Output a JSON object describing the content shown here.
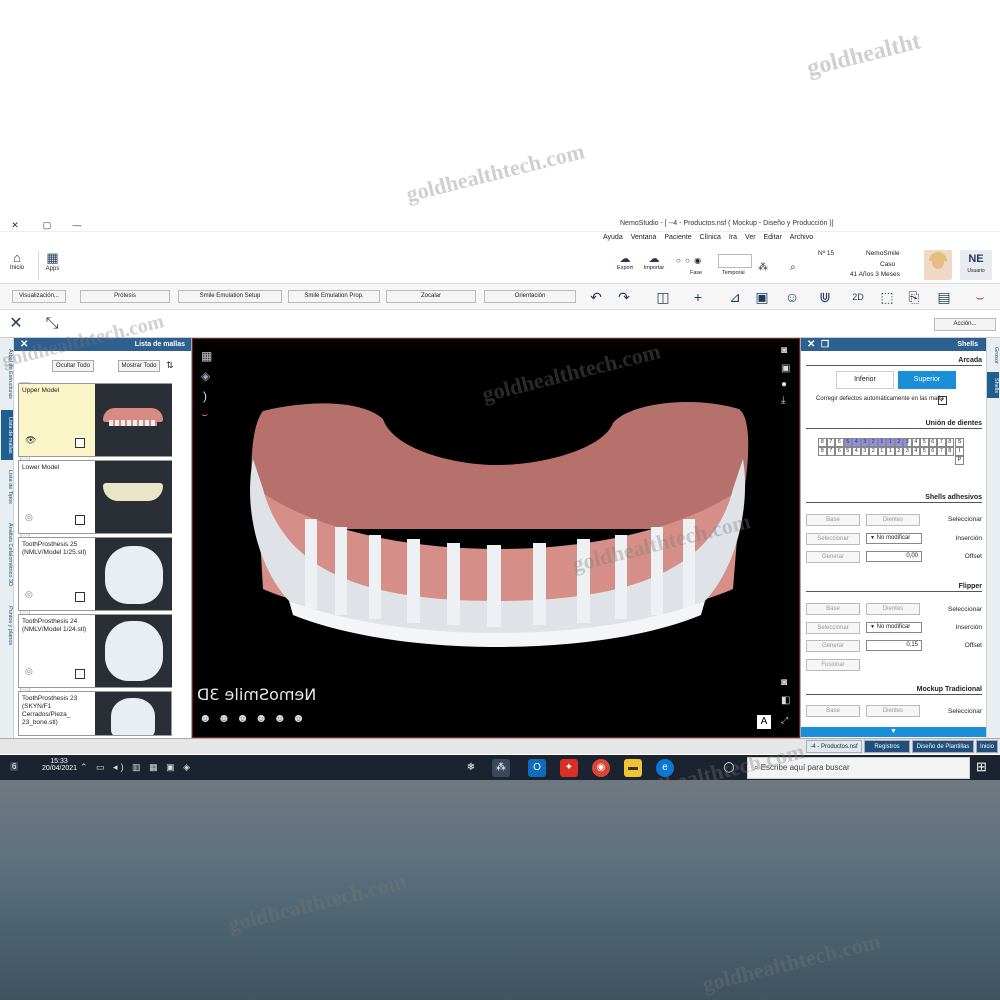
{
  "window": {
    "title": "NemoStudio - [ --4 - Productos.nsf ( Mockup - Diseño y Producción )]",
    "close": "✕",
    "maximize": "▢",
    "minimize": "—"
  },
  "menu": [
    "Archivo",
    "Editar",
    "Ver",
    "Ira",
    "Clínica",
    "Paciente",
    "Ventana",
    "Ayuda"
  ],
  "home": {
    "inicio": "Inicio",
    "apps": "Apps"
  },
  "patient": {
    "initials": "NE",
    "initials_sub": "Usuario",
    "name": "NemoSmile",
    "case_label": "Caso",
    "age": "41 Años 3 Meses",
    "number": "Nº 15"
  },
  "ribbon_tools": {
    "temporal": "Temporal",
    "fase": "Fase",
    "importar": "Importar",
    "exportar": "Export"
  },
  "toolbar_buttons": [
    "Visualización...",
    "Prótesis",
    "Smile Emulation Setup",
    "Smile Emulation Prop.",
    "Zocalar",
    "Orientación"
  ],
  "accion": "Acción...",
  "left_tabs": [
    "Árbol de Estructuras",
    "Lista de mallas",
    "Lista de Tipos",
    "Análisis Cefalométrico 3D",
    "Puntos y planos"
  ],
  "mesh_panel": {
    "title": "Lista de mallas",
    "show_all": "Mostrar Todo",
    "hide_all": "Ocultar Todo",
    "items": [
      {
        "label": "Upper Model"
      },
      {
        "label": "Lower Model"
      },
      {
        "label": "ToothProsthesis 25 (NMLV/Model 1/25.stl)"
      },
      {
        "label": "ToothProsthesis 24 (NMLV/Model 1/24.stl)"
      },
      {
        "label": "ToothProsthesis 23 (SKYN/F1 Cerrados/Pieza_ 23_bone.stl)"
      }
    ]
  },
  "viewport": {
    "brand": "NemoSmile 3D",
    "badge": "A"
  },
  "shells_panel": {
    "title": "Shells",
    "arcada": "Arcada",
    "superior": "Superior",
    "inferior": "Inferior",
    "corregir": "Corregir defectos automáticamente en las malla",
    "union": "Unión de dientes",
    "tooth_top": [
      "8",
      "7",
      "6",
      "5",
      "4",
      "3",
      "2",
      "1",
      "1",
      "2",
      "3",
      "4",
      "5",
      "6",
      "7",
      "8"
    ],
    "tooth_bottom": [
      "8",
      "7",
      "6",
      "5",
      "4",
      "3",
      "2",
      "1",
      "1",
      "2",
      "3",
      "4",
      "5",
      "6",
      "7",
      "8"
    ],
    "rows": [
      "S",
      "I",
      "P"
    ],
    "adhesivos": {
      "title": "Shells adhesivos",
      "seleccionar": "Seleccionar",
      "dientes": "Dientes",
      "base": "Base",
      "insercion": "Inserción",
      "insercion_val": "No modificar",
      "seleccionar_btn": "Seleccionar",
      "offset": "Offset",
      "offset_val": "0,00",
      "generar": "Generar"
    },
    "flipper": {
      "title": "Flipper",
      "seleccionar": "Seleccionar",
      "dientes": "Dientes",
      "base": "Base",
      "insercion": "Inserción",
      "insercion_val": "No modificar",
      "seleccionar_btn": "Seleccionar",
      "offset": "Offset",
      "offset_val": "0,15",
      "generar": "Generar",
      "fusionar": "Fusionar"
    },
    "mockup": {
      "title": "Mockup Tradicional",
      "seleccionar": "Seleccionar",
      "dientes": "Dientes",
      "base": "Base"
    }
  },
  "right_tabs": [
    "Grosor",
    "Shells"
  ],
  "status_tabs": [
    "Inicio",
    "Diseño de Plantillas",
    "Registros",
    "-4 - Productos.nsf"
  ],
  "taskbar": {
    "search": "Escribe aquí para buscar",
    "time": "15:33",
    "date": "20/04/2021",
    "notif": "6"
  },
  "watermark": "goldhealthtech.com",
  "watermark_short": "goldhealtht"
}
